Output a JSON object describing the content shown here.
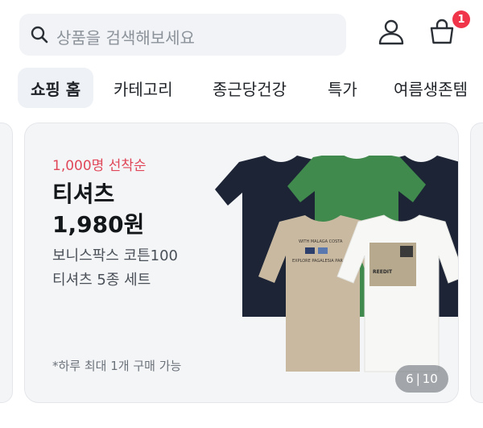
{
  "header": {
    "search": {
      "placeholder": "상품을 검색해보세요",
      "icon": "search-icon"
    },
    "user_icon": "user-icon",
    "cart": {
      "icon": "shopping-bag-icon",
      "badge_count": "1"
    }
  },
  "tabs": [
    {
      "label": "쇼핑 홈",
      "active": true
    },
    {
      "label": "카테고리",
      "active": false
    },
    {
      "label": "종근당건강",
      "active": false
    },
    {
      "label": "특가",
      "active": false
    },
    {
      "label": "여름생존템",
      "active": false
    }
  ],
  "banner": {
    "promo": "1,000명 선착순",
    "title": "티셔츠",
    "price": "1,980원",
    "desc_line1": "보니스팍스 코튼100",
    "desc_line2": "티셔츠 5종 세트",
    "note": "*하루 최대 1개 구매 가능",
    "counter": {
      "current": "6",
      "separator": "|",
      "total": "10"
    },
    "tshirt_print": {
      "beige_line1": "WITH  MALAGA  COSTA",
      "beige_line2": "EXPLORE  PAGALESIA  PARA",
      "white_label": "REEDIT"
    }
  },
  "colors": {
    "accent_red": "#f0354b",
    "promo_text": "#e0485a",
    "tee_navy": "#1c2436",
    "tee_green": "#3f8a4c",
    "tee_beige": "#c9b9a0",
    "tee_white": "#f7f7f5"
  }
}
